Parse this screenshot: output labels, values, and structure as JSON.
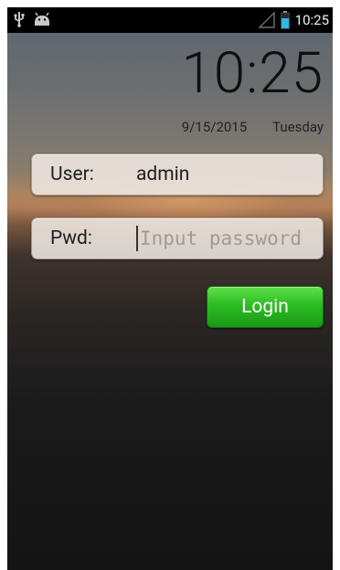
{
  "status_bar": {
    "left_icons": [
      "usb-icon",
      "android-icon"
    ],
    "right_icons": [
      "signal-icon",
      "battery-icon"
    ],
    "time": "10:25"
  },
  "lock_screen": {
    "clock": "10:25",
    "date": "9/15/2015",
    "weekday": "Tuesday"
  },
  "login_form": {
    "user_label": "User:",
    "user_value": "admin",
    "pwd_label": "Pwd:",
    "pwd_placeholder": "Input password",
    "login_button_label": "Login"
  },
  "colors": {
    "status_bar_bg": "#000000",
    "button_accent": "#2cbc22",
    "battery": "#33b5e5"
  }
}
